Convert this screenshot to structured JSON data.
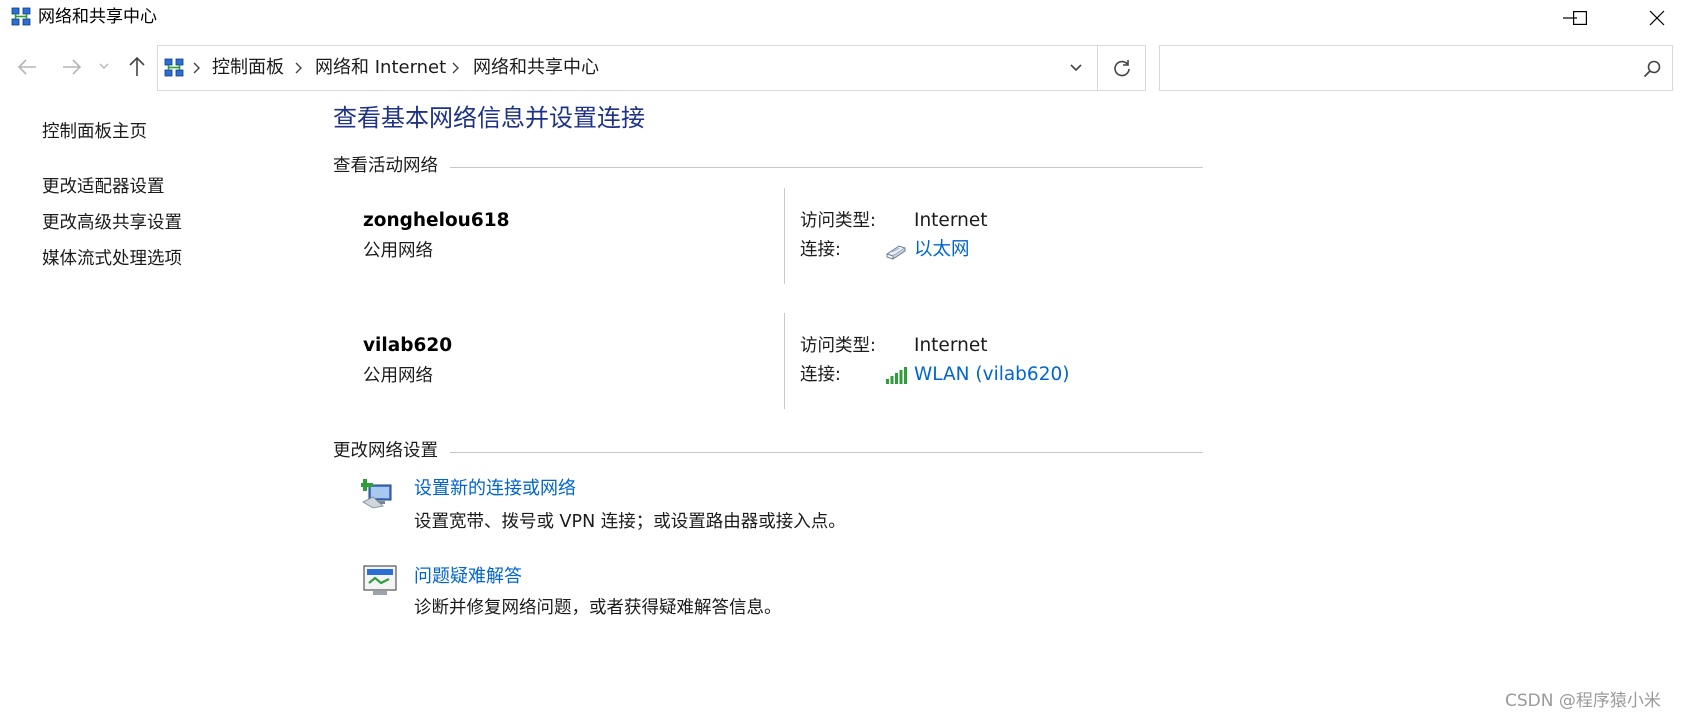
{
  "window": {
    "title": "网络和共享中心"
  },
  "address_bar": {
    "breadcrumbs": [
      "控制面板",
      "网络和 Internet",
      "网络和共享中心"
    ],
    "search_placeholder": ""
  },
  "left_nav": {
    "home": "控制面板主页",
    "items": [
      "更改适配器设置",
      "更改高级共享设置",
      "媒体流式处理选项"
    ]
  },
  "main": {
    "title": "查看基本网络信息并设置连接",
    "active_section": "查看活动网络",
    "networks": [
      {
        "name": "zonghelou618",
        "type": "公用网络",
        "access_label": "访问类型:",
        "access_value": "Internet",
        "connection_label": "连接:",
        "connection_value": "以太网",
        "connection_icon": "ethernet-icon"
      },
      {
        "name": "vilab620",
        "type": "公用网络",
        "access_label": "访问类型:",
        "access_value": "Internet",
        "connection_label": "连接:",
        "connection_value": "WLAN (vilab620)",
        "connection_icon": "wifi-signal-icon"
      }
    ],
    "change_section": "更改网络设置",
    "tasks": [
      {
        "link": "设置新的连接或网络",
        "desc": "设置宽带、拨号或 VPN 连接；或设置路由器或接入点。",
        "icon": "new-connection-icon"
      },
      {
        "link": "问题疑难解答",
        "desc": "诊断并修复网络问题，或者获得疑难解答信息。",
        "icon": "troubleshoot-icon"
      }
    ]
  },
  "watermark": "CSDN @程序猿小米",
  "colors": {
    "link": "#0066cc",
    "title": "#1e3287",
    "rule": "#c8c8c8"
  }
}
